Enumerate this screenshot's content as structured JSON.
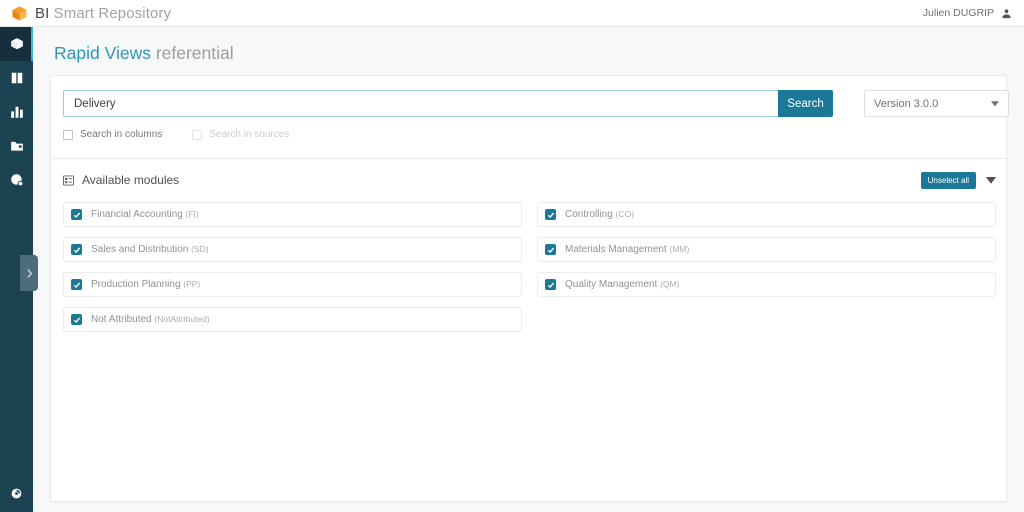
{
  "topbar": {
    "logo_icon": "orange-cube-icon",
    "brand_primary": "BI",
    "brand_secondary": " Smart Repository",
    "user_name": "Julien DUGRIP",
    "user_icon": "person-icon"
  },
  "sidebar": {
    "items": [
      {
        "icon": "cube-icon",
        "name": "repository",
        "active": true
      },
      {
        "icon": "book-icon",
        "name": "library",
        "active": false
      },
      {
        "icon": "bar-chart-icon",
        "name": "analytics",
        "active": false
      },
      {
        "icon": "folder-icon",
        "name": "projects",
        "active": false
      },
      {
        "icon": "globe-icon",
        "name": "global",
        "active": false
      }
    ],
    "bottom_item": {
      "icon": "help-icon",
      "name": "help"
    },
    "expand_handle_icon": "chevron-right-icon",
    "accent_color": "#39b4de",
    "background_color": "#1b4352"
  },
  "page": {
    "title_accent": "Rapid Views",
    "title_sub": " referential"
  },
  "search": {
    "value": "Delivery",
    "placeholder": "Search",
    "button_label": "Search",
    "button_color": "#1b7898",
    "version_label": "Version 3.0.0",
    "options": [
      {
        "label": "Search in columns",
        "checked": false,
        "disabled": false
      },
      {
        "label": "Search in sources",
        "checked": false,
        "disabled": true
      }
    ]
  },
  "modules": {
    "panel_title": "Available modules",
    "panel_icon": "grid-list-icon",
    "unselect_label": "Unselect all",
    "collapse_icon": "caret-down-icon",
    "checkbox_color": "#1b7898",
    "items": [
      {
        "label": "Financial Accounting",
        "code": "(FI)",
        "checked": true
      },
      {
        "label": "Controlling",
        "code": "(CO)",
        "checked": true
      },
      {
        "label": "Sales and Distribution",
        "code": "(SD)",
        "checked": true
      },
      {
        "label": "Materials Management",
        "code": "(MM)",
        "checked": true
      },
      {
        "label": "Production Planning",
        "code": "(PP)",
        "checked": true
      },
      {
        "label": "Quality Management",
        "code": "(QM)",
        "checked": true
      },
      {
        "label": "Not Attributed",
        "code": "(NotAttributed)",
        "checked": true
      }
    ]
  }
}
